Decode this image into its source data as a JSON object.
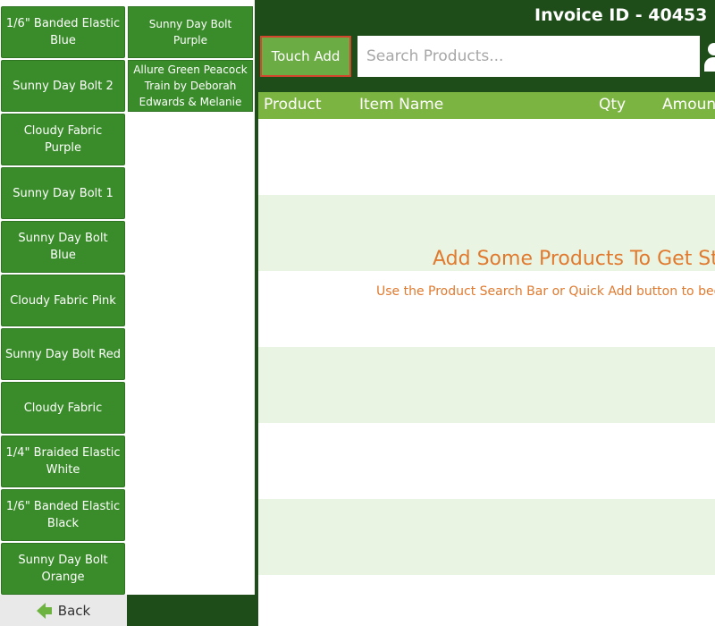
{
  "header": {
    "invoice_title": "Invoice ID - 40453"
  },
  "quick_add": {
    "column1": [
      "1/6\" Banded Elastic Blue",
      "Sunny Day Bolt 2",
      "Cloudy Fabric Purple",
      "Sunny Day Bolt 1",
      "Sunny Day Bolt Blue",
      "Cloudy Fabric Pink",
      "Sunny Day Bolt Red",
      "Cloudy Fabric",
      "1/4\" Braided Elastic White",
      "1/6\" Banded Elastic Black",
      "Sunny Day Bolt Orange"
    ],
    "column2": [
      "Sunny Day Bolt Purple",
      "Allure Green Peacock Train by Deborah Edwards & Melanie"
    ],
    "back_label": "Back"
  },
  "toolbar": {
    "touch_add_label": "Touch Add",
    "search_placeholder": "Search Products..."
  },
  "table": {
    "columns": [
      "Product",
      "Item Name",
      "Qty",
      "Amount"
    ]
  },
  "empty_state": {
    "title": "Add Some Products To Get Started",
    "subtitle": "Use the Product Search Bar or Quick Add button to begin"
  },
  "icons": {
    "back": "arrow-left-icon",
    "user": "user-icon"
  },
  "colors": {
    "background": "#1e4d1a",
    "tile_green": "#3a8c2a",
    "header_green": "#7cb442",
    "accent_orange": "#e07a2f",
    "focus_border": "#d4452d"
  }
}
